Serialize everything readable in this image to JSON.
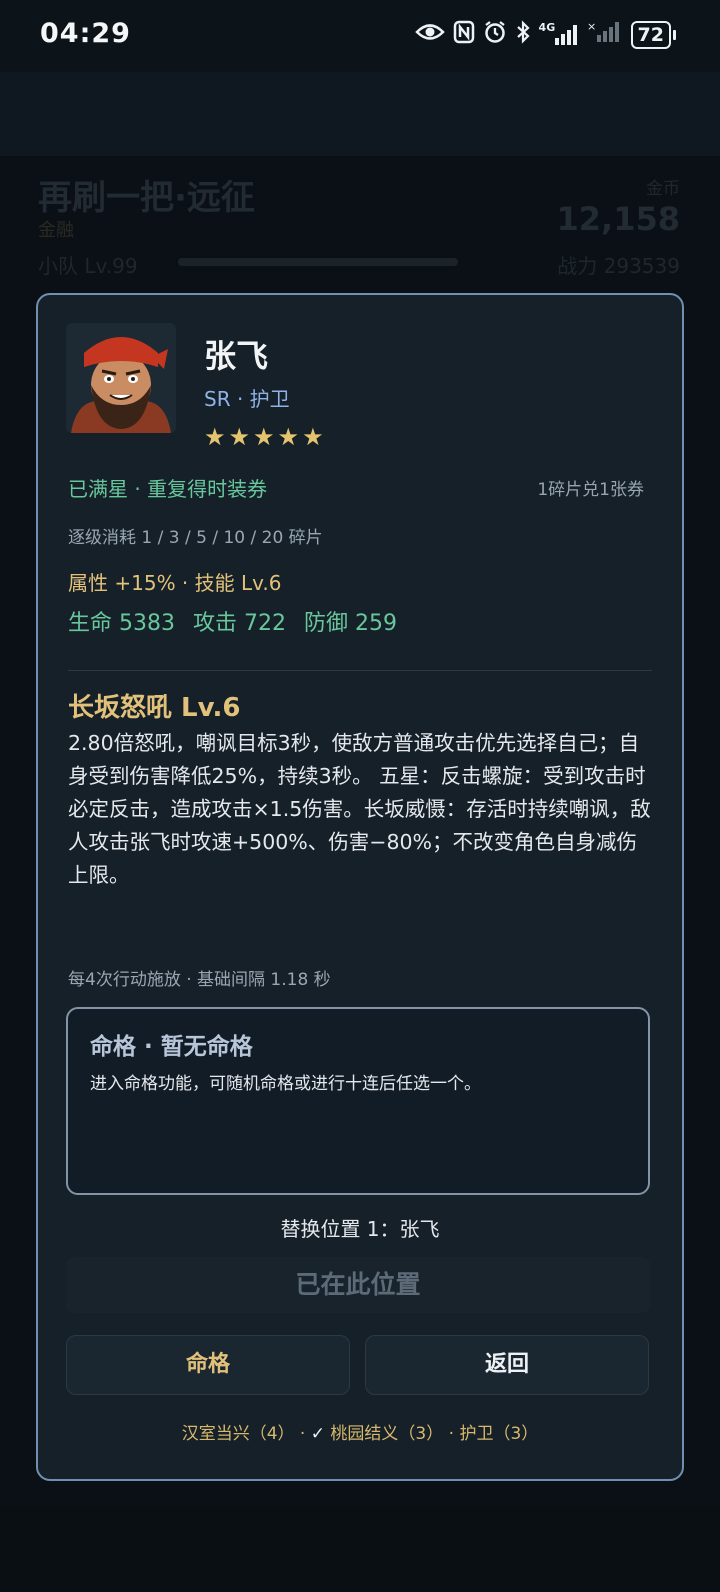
{
  "status_bar": {
    "time": "04:29",
    "network": "4G",
    "battery": "72",
    "icons": [
      "eye-icon",
      "nfc-icon",
      "alarm-icon",
      "bluetooth-icon",
      "signal-4g-icon",
      "signal-2-icon",
      "battery-icon"
    ]
  },
  "background_page": {
    "title": "再刷一把·远征",
    "subtitle": "金融",
    "level": "小队 Lv.99",
    "gold_label": "金币",
    "gold_value": "12,158",
    "power": "战力 293539"
  },
  "modal": {
    "hero": {
      "name": "张飞",
      "rarity": "SR · 护卫",
      "stars": "★★★★★",
      "star_count": 5
    },
    "max_star_text": "已满星 · 重复得时装券",
    "exchange_text": "1碎片兑1张券",
    "cost_text": "逐级消耗 1 / 3 / 5 / 10 / 20 碎片",
    "attr_text": "属性 +15% · 技能 Lv.6",
    "stats": {
      "hp": "生命 5383",
      "atk": "攻击 722",
      "def": "防御 259"
    },
    "skill": {
      "title": "长坂怒吼 Lv.6",
      "description": "2.80倍怒吼，嘲讽目标3秒，使敌方普通攻击优先选择自己；自身受到伤害降低25%，持续3秒。 五星：反击螺旋：受到攻击时必定反击，造成攻击×1.5伤害。长坂威慑：存活时持续嘲讽，敌人攻击张飞时攻速+500%、伤害−80%；不改变角色自身减伤上限。",
      "meta": "每4次行动施放 · 基础间隔 1.18 秒"
    },
    "fate": {
      "title": "命格 · 暂无命格",
      "description": "进入命格功能，可随机命格或进行十连后任选一个。"
    },
    "replace_text": "替换位置 1：张飞",
    "in_position_button": "已在此位置",
    "fate_button": "命格",
    "back_button": "返回",
    "bonds": {
      "bond1": "汉室当兴（4）",
      "sep1": " · ",
      "check": "✓",
      "bond2": " 桃园结义（3）",
      "sep2": " · ",
      "bond3": "护卫（3）"
    }
  },
  "colors": {
    "accent_gold": "#e2c27a",
    "accent_green": "#69c79c",
    "rarity_blue": "#8fb3e6",
    "modal_border": "#6f8fb3"
  }
}
